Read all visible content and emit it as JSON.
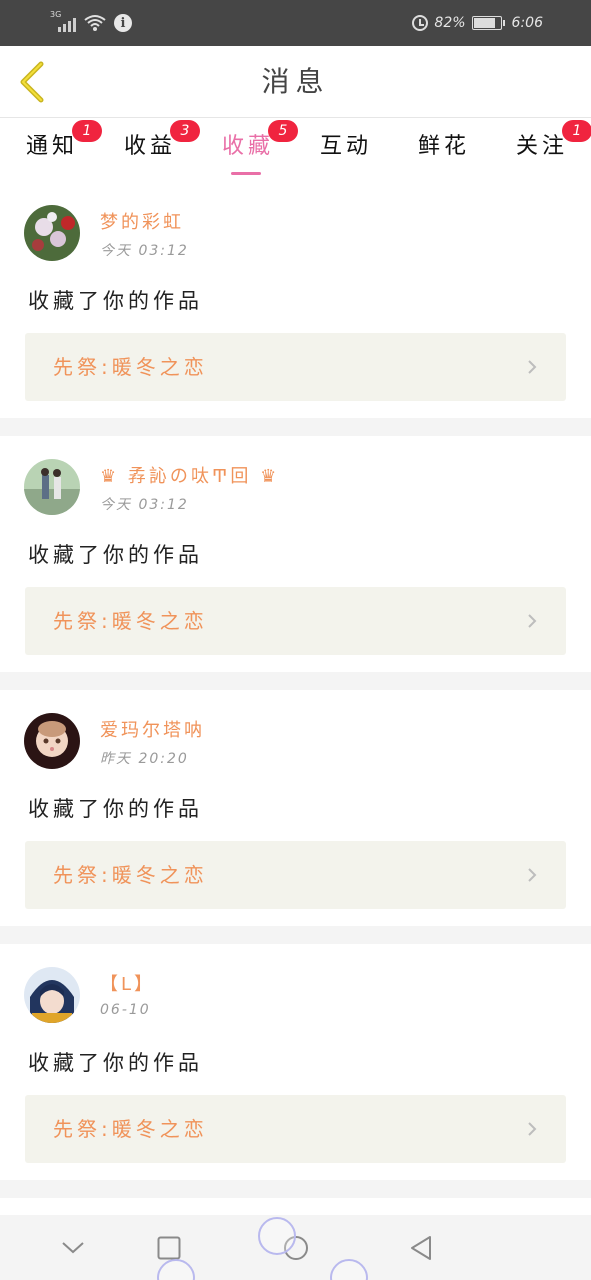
{
  "status_bar": {
    "network": "3G",
    "battery_percent": "82%",
    "battery_level": 0.82,
    "time": "6:06"
  },
  "header": {
    "title": "消息"
  },
  "tabs": [
    {
      "label": "通知",
      "badge": "1",
      "active": false
    },
    {
      "label": "收益",
      "badge": "3",
      "active": false
    },
    {
      "label": "收藏",
      "badge": "5",
      "active": true
    },
    {
      "label": "互动",
      "badge": "",
      "active": false
    },
    {
      "label": "鲜花",
      "badge": "",
      "active": false
    },
    {
      "label": "关注",
      "badge": "1",
      "active": false
    }
  ],
  "feed": [
    {
      "username": "梦的彩虹",
      "time": "今天 03:12",
      "action": "收藏了你的作品",
      "work_title": "先祭:暖冬之恋"
    },
    {
      "username": "♛ 孨訫の呔Ͳ回 ♛",
      "time": "今天 03:12",
      "action": "收藏了你的作品",
      "work_title": "先祭:暖冬之恋"
    },
    {
      "username": "爱玛尔塔呐",
      "time": "昨天 20:20",
      "action": "收藏了你的作品",
      "work_title": "先祭:暖冬之恋"
    },
    {
      "username": "【L】",
      "time": "06-10",
      "action": "收藏了你的作品",
      "work_title": "先祭:暖冬之恋"
    }
  ],
  "colors": {
    "accent": "#e96fa7",
    "badge": "#f0243f",
    "username": "#f0935a",
    "status_bar": "#464646",
    "work_box": "#f3f3ec"
  },
  "icons": {
    "back": "chevron-left-icon",
    "work_arrow": "chevron-right-icon",
    "nav_down": "chevron-down-icon",
    "nav_recent": "square-icon",
    "nav_home": "circle-icon",
    "nav_back": "triangle-back-icon"
  }
}
